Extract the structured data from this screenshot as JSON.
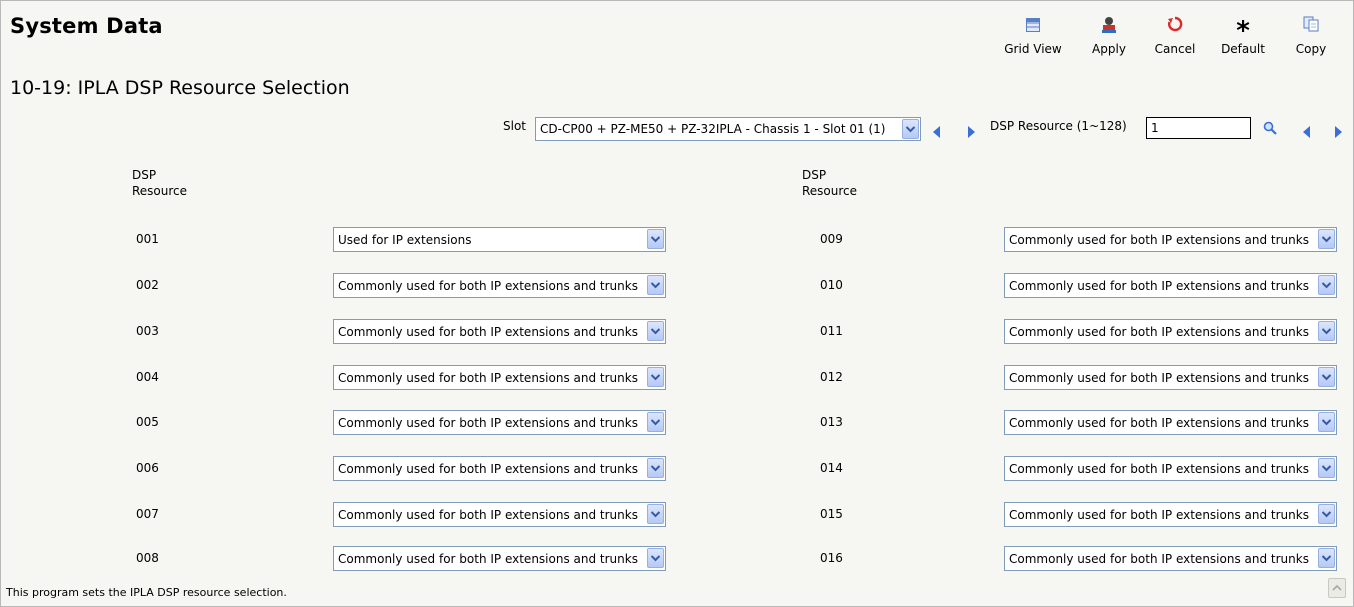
{
  "header": {
    "title": "System Data",
    "subtitle": "10-19: IPLA DSP Resource Selection"
  },
  "toolbar": {
    "buttons": [
      {
        "label": "Grid View",
        "icon": "grid-view-icon"
      },
      {
        "label": "Apply",
        "icon": "apply-icon"
      },
      {
        "label": "Cancel",
        "icon": "cancel-icon"
      },
      {
        "label": "Default",
        "icon": "default-asterisk-icon"
      },
      {
        "label": "Copy",
        "icon": "copy-icon"
      }
    ]
  },
  "filters": {
    "slot_label": "Slot",
    "slot_value": "CD-CP00 + PZ-ME50 + PZ-32IPLA - Chassis 1 - Slot 01 (1)",
    "dsp_label": "DSP Resource (1~128)",
    "dsp_value": "1"
  },
  "columns": {
    "left_header_line1": "DSP",
    "left_header_line2": "Resource",
    "right_header_line1": "DSP",
    "right_header_line2": "Resource"
  },
  "rows_left": [
    {
      "num": "001",
      "value": "Used for IP extensions"
    },
    {
      "num": "002",
      "value": "Commonly used for both IP extensions and trunks"
    },
    {
      "num": "003",
      "value": "Commonly used for both IP extensions and trunks"
    },
    {
      "num": "004",
      "value": "Commonly used for both IP extensions and trunks"
    },
    {
      "num": "005",
      "value": "Commonly used for both IP extensions and trunks"
    },
    {
      "num": "006",
      "value": "Commonly used for both IP extensions and trunks"
    },
    {
      "num": "007",
      "value": "Commonly used for both IP extensions and trunks"
    },
    {
      "num": "008",
      "value": "Commonly used for both IP extensions and trunks"
    }
  ],
  "rows_right": [
    {
      "num": "009",
      "value": "Commonly used for both IP extensions and trunks"
    },
    {
      "num": "010",
      "value": "Commonly used for both IP extensions and trunks"
    },
    {
      "num": "011",
      "value": "Commonly used for both IP extensions and trunks"
    },
    {
      "num": "012",
      "value": "Commonly used for both IP extensions and trunks"
    },
    {
      "num": "013",
      "value": "Commonly used for both IP extensions and trunks"
    },
    {
      "num": "014",
      "value": "Commonly used for both IP extensions and trunks"
    },
    {
      "num": "015",
      "value": "Commonly used for both IP extensions and trunks"
    },
    {
      "num": "016",
      "value": "Commonly used for both IP extensions and trunks"
    }
  ],
  "footer": {
    "text": "This program sets the IPLA DSP resource selection."
  },
  "colors": {
    "arrow_blue": "#3a6fd8",
    "cancel_red": "#d92b2b",
    "input_border": "#7f9db9"
  }
}
